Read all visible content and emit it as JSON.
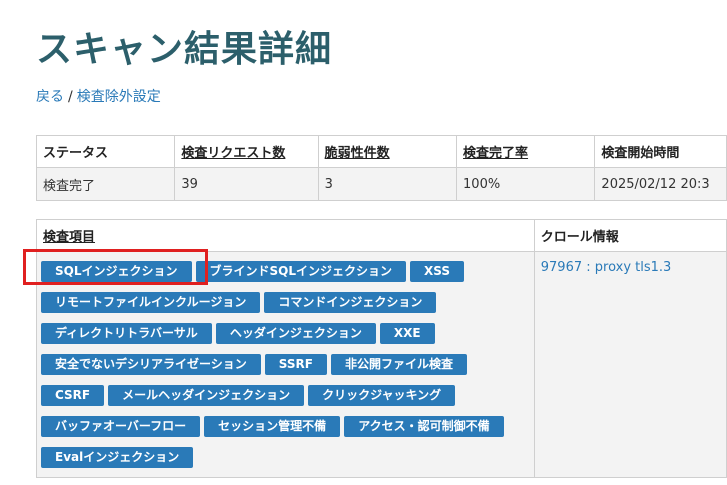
{
  "page": {
    "title": "スキャン結果詳細"
  },
  "breadcrumb": {
    "back": "戻る",
    "separator": "/",
    "exclusion": "検査除外設定"
  },
  "status_table": {
    "headers": [
      "ステータス",
      "検査リクエスト数",
      "脆弱性件数",
      "検査完了率",
      "検査開始時間"
    ],
    "row": [
      "検査完了",
      "39",
      "3",
      "100%",
      "2025/02/12 20:3"
    ]
  },
  "detail_table": {
    "items_header": "検査項目",
    "crawl_header": "クロール情報",
    "crawl_link": "97967 : proxy tls1.3",
    "items": [
      "SQLインジェクション",
      "ブラインドSQLインジェクション",
      "XSS",
      "リモートファイルインクルージョン",
      "コマンドインジェクション",
      "ディレクトリトラバーサル",
      "ヘッダインジェクション",
      "XXE",
      "安全でないデシリアライゼーション",
      "SSRF",
      "非公開ファイル検査",
      "CSRF",
      "メールヘッダインジェクション",
      "クリックジャッキング",
      "バッファオーバーフロー",
      "セッション管理不備",
      "アクセス・認可制御不備",
      "Evalインジェクション"
    ]
  },
  "colors": {
    "title": "#2c5f6b",
    "link": "#2a7ab8",
    "tag": "#2a7ab8",
    "highlight": "#e02020"
  }
}
